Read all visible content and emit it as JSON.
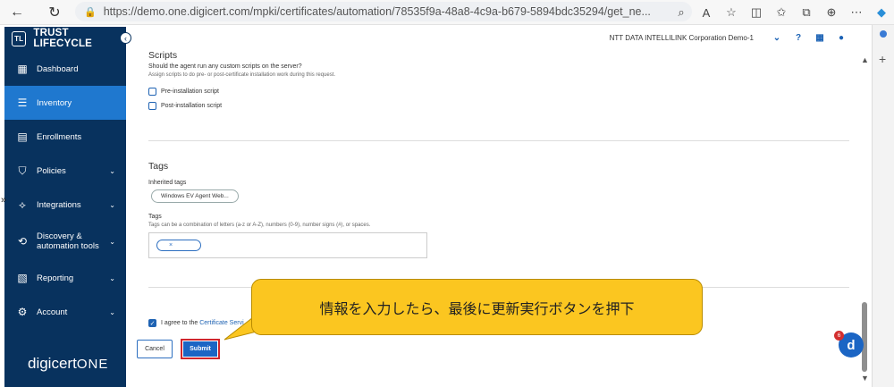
{
  "browser": {
    "url": "https://demo.one.digicert.com/mpki/certificates/automation/78535f9a-48a8-4c9a-b679-5894bdc35294/get_ne..."
  },
  "sidebar": {
    "brand": "TRUST LIFECYCLE",
    "brand_logo": "TL",
    "items": [
      {
        "label": "Dashboard",
        "icon": "dashboard-icon"
      },
      {
        "label": "Inventory",
        "icon": "inventory-icon"
      },
      {
        "label": "Enrollments",
        "icon": "enrollments-icon"
      },
      {
        "label": "Policies",
        "icon": "shield-icon"
      },
      {
        "label": "Integrations",
        "icon": "integrations-icon"
      },
      {
        "label": "Discovery & automation tools",
        "icon": "discovery-icon"
      },
      {
        "label": "Reporting",
        "icon": "report-icon"
      },
      {
        "label": "Account",
        "icon": "account-icon"
      }
    ],
    "footer_logo_main": "digicert",
    "footer_logo_sub": "ONE"
  },
  "topbar": {
    "org": "NTT DATA INTELLILINK Corporation Demo-1"
  },
  "scripts": {
    "title": "Scripts",
    "question": "Should the agent run any custom scripts on the server?",
    "hint": "Assign scripts to do pre- or post-certificate installation work during this request.",
    "pre_label": "Pre-installation script",
    "post_label": "Post-installation script"
  },
  "tags": {
    "title": "Tags",
    "inherited_label": "Inherited tags",
    "inherited_tag": "Windows EV Agent Web...",
    "tags_label": "Tags",
    "tags_hint": "Tags can be a combination of letters (a-z or A-Z), numbers (0-9), number signs (#), or spaces.",
    "empty_tag_x": "×"
  },
  "agreement": {
    "prefix": "I agree to the",
    "link": "Certificate Servi"
  },
  "buttons": {
    "cancel": "Cancel",
    "submit": "Submit"
  },
  "callout": {
    "text": "情報を入力したら、最後に更新実行ボタンを押下"
  },
  "chat": {
    "letter": "d",
    "badge": "6"
  },
  "colors": {
    "sidebar": "#08325e",
    "active": "#1f78cf",
    "accent": "#1b65c4",
    "callout": "#fbc620",
    "highlight": "#d0262d"
  }
}
